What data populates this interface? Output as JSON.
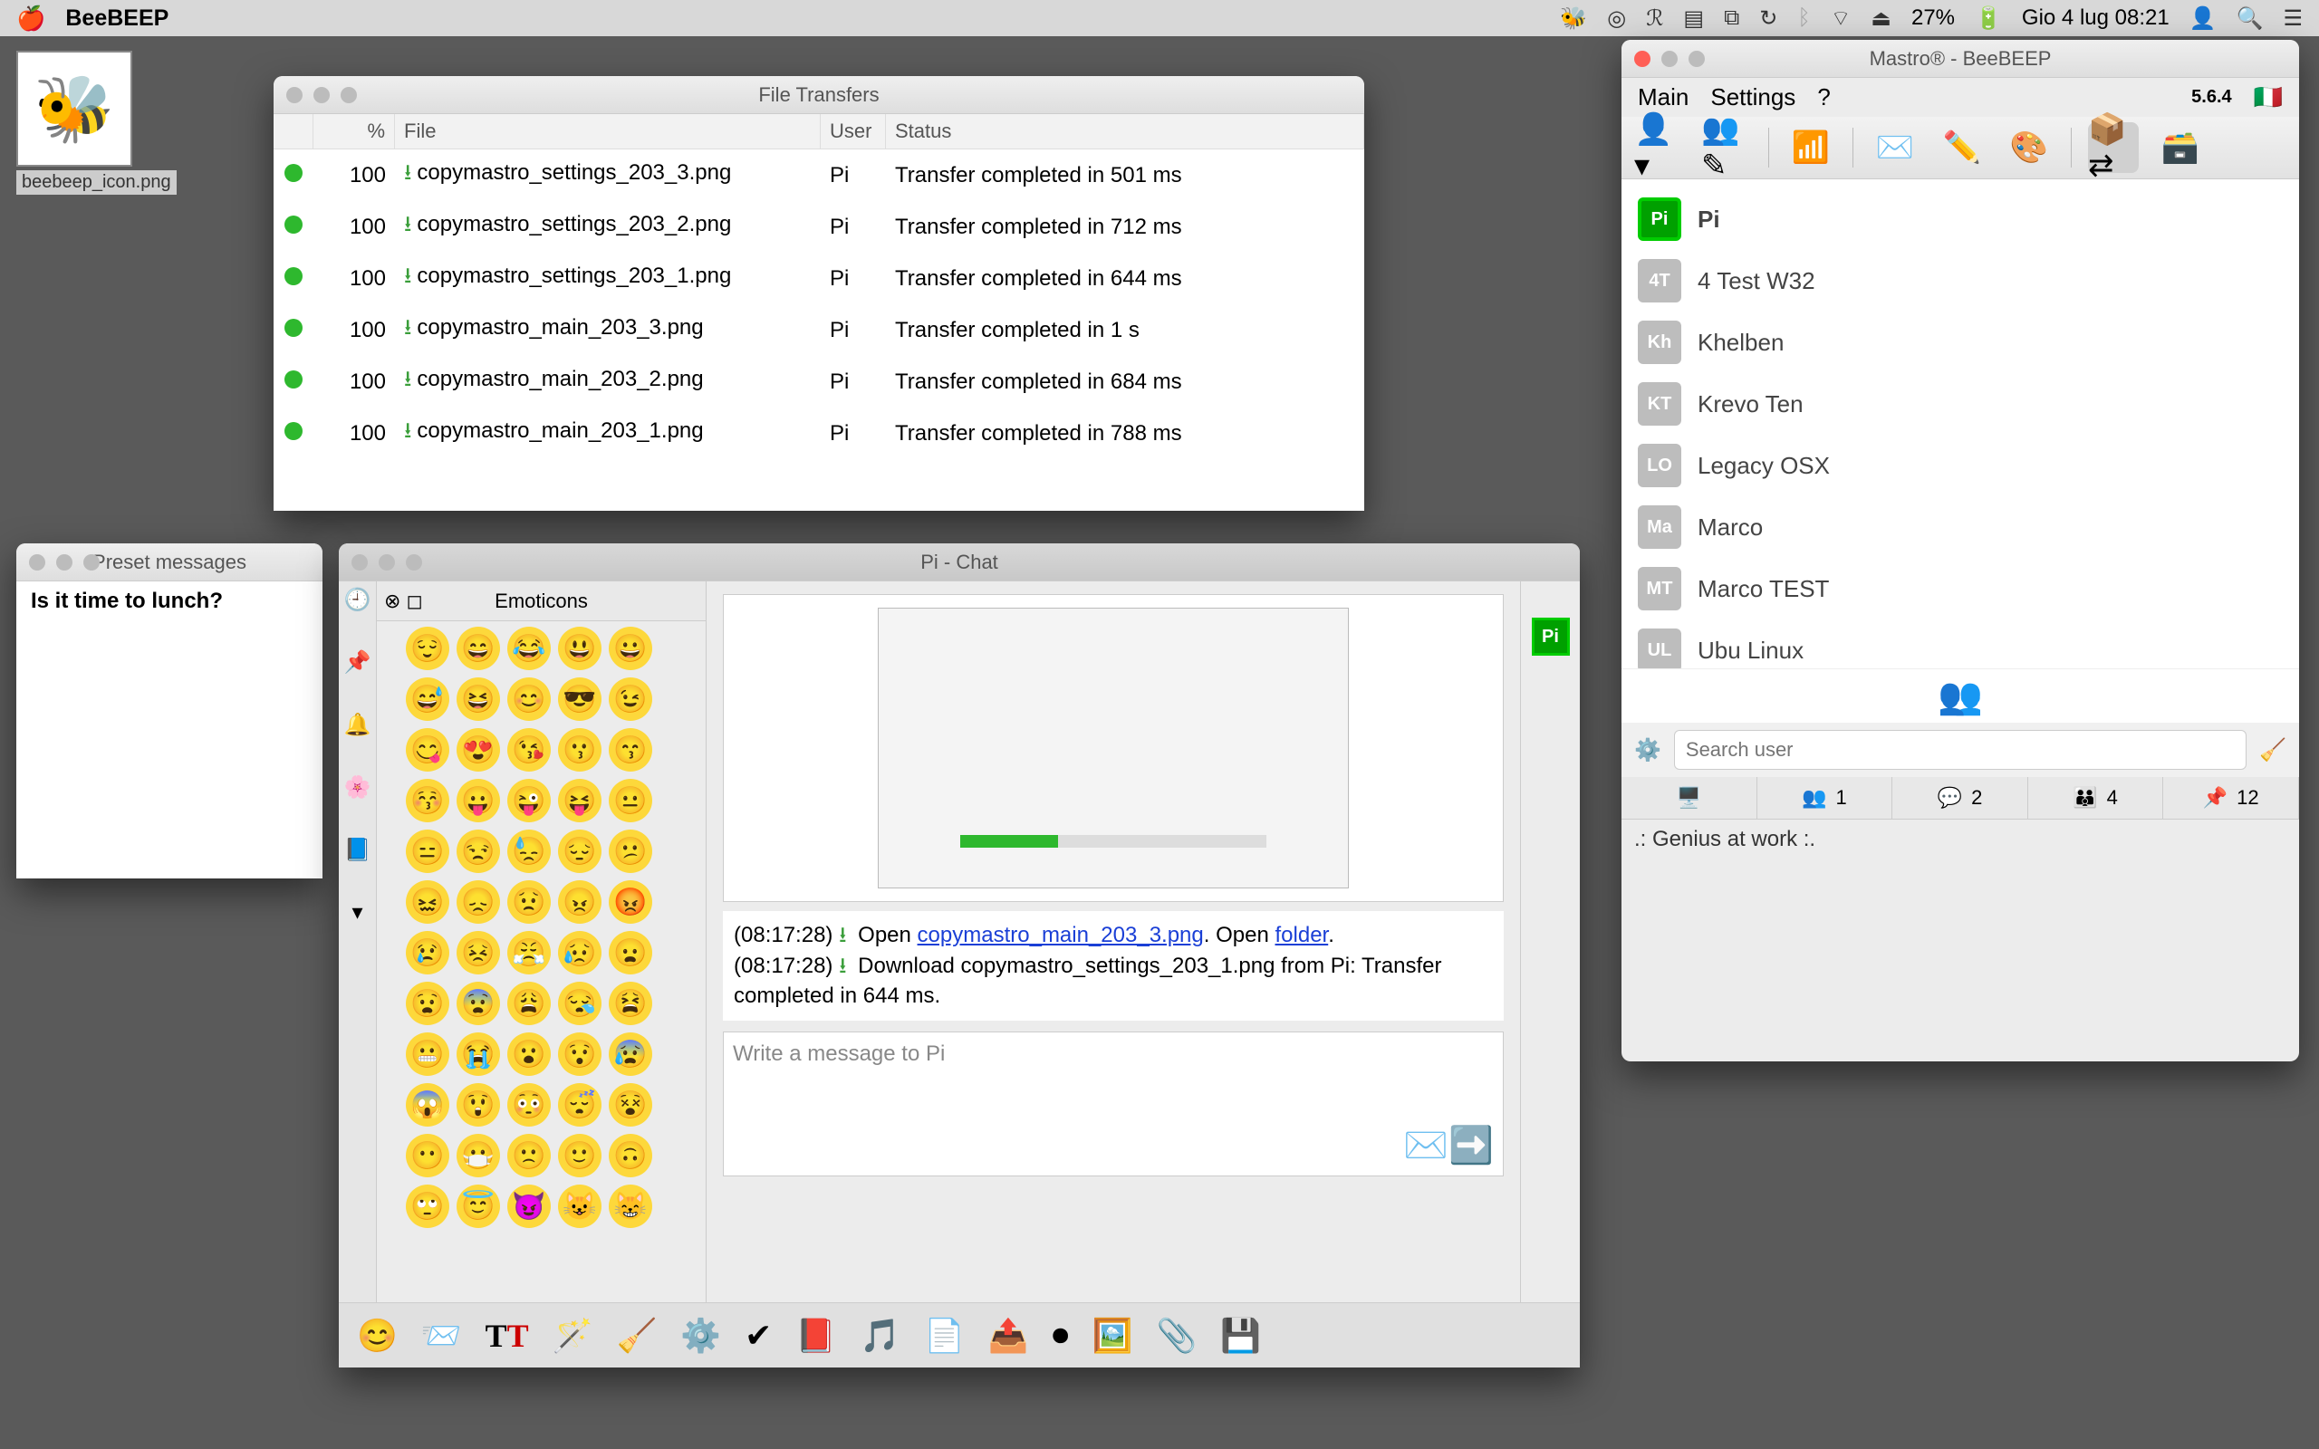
{
  "menubar": {
    "app": "BeeBEEP",
    "battery": "27%",
    "clock": "Gio 4 lug  08:21"
  },
  "desktop": {
    "icon_label": "beebeep_icon.png"
  },
  "file_transfers": {
    "title": "File Transfers",
    "headers": {
      "pct": "%",
      "file": "File",
      "user": "User",
      "status": "Status"
    },
    "rows": [
      {
        "pct": "100",
        "file": "copymastro_settings_203_3.png",
        "user": "Pi",
        "status": "Transfer completed in 501 ms"
      },
      {
        "pct": "100",
        "file": "copymastro_settings_203_2.png",
        "user": "Pi",
        "status": "Transfer completed in 712 ms"
      },
      {
        "pct": "100",
        "file": "copymastro_settings_203_1.png",
        "user": "Pi",
        "status": "Transfer completed in 644 ms"
      },
      {
        "pct": "100",
        "file": "copymastro_main_203_3.png",
        "user": "Pi",
        "status": "Transfer completed in 1 s"
      },
      {
        "pct": "100",
        "file": "copymastro_main_203_2.png",
        "user": "Pi",
        "status": "Transfer completed in 684 ms"
      },
      {
        "pct": "100",
        "file": "copymastro_main_203_1.png",
        "user": "Pi",
        "status": "Transfer completed in 788 ms"
      }
    ]
  },
  "preset": {
    "title": "Preset messages",
    "items": [
      "Is it time to lunch?"
    ]
  },
  "chat": {
    "title": "Pi - Chat",
    "emoticons_title": "Emoticons",
    "log": {
      "t1": "(08:17:28)",
      "open_word": "Open",
      "link1": "copymastro_main_203_3.png",
      "open_folder": "Open",
      "folder": "folder",
      "t2": "(08:17:28)",
      "line2": "Download copymastro_settings_203_1.png from Pi: Transfer completed in 644 ms."
    },
    "input_placeholder": "Write a message to Pi",
    "avatar": "Pi"
  },
  "main": {
    "title": "Mastro® - BeeBEEP",
    "menu": {
      "main": "Main",
      "settings": "Settings",
      "help": "?"
    },
    "version": "5.6.4",
    "users": [
      {
        "initials": "Pi",
        "name": "Pi",
        "cls": "pi",
        "sel": true
      },
      {
        "initials": "4T",
        "name": "4 Test W32",
        "cls": "gray"
      },
      {
        "initials": "Kh",
        "name": "Khelben",
        "cls": "gray"
      },
      {
        "initials": "KT",
        "name": "Krevo Ten",
        "cls": "gray"
      },
      {
        "initials": "LO",
        "name": "Legacy OSX",
        "cls": "gray"
      },
      {
        "initials": "Ma",
        "name": "Marco",
        "cls": "gray"
      },
      {
        "initials": "MT",
        "name": "Marco TEST",
        "cls": "gray"
      },
      {
        "initials": "UL",
        "name": "Ubu Linux",
        "cls": "gray"
      }
    ],
    "search_placeholder": "Search user",
    "stats": {
      "online": "1",
      "chats": "2",
      "groups": "4",
      "files": "12"
    },
    "status": ".: Genius at work :."
  }
}
